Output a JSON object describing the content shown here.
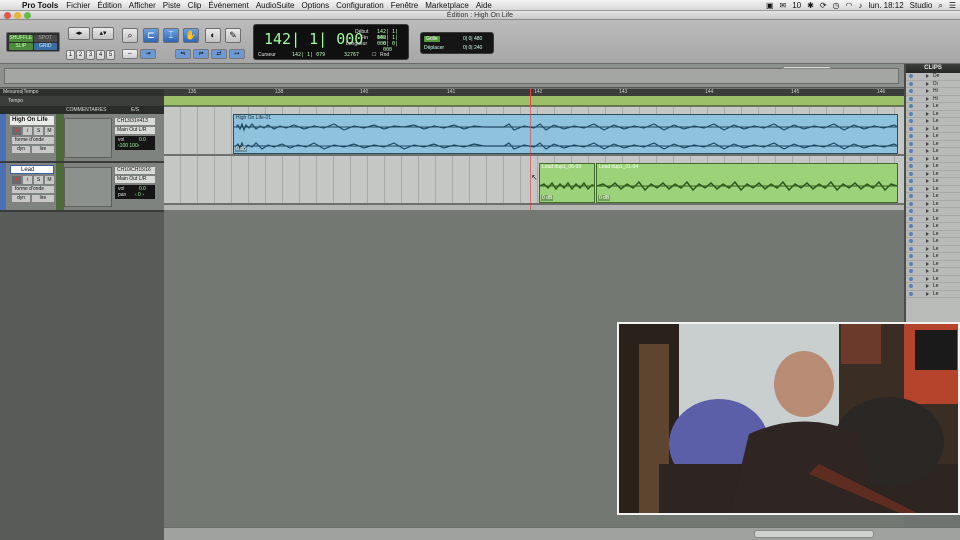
{
  "menubar": {
    "app_name": "Pro Tools",
    "items": [
      "Fichier",
      "Édition",
      "Afficher",
      "Piste",
      "Clip",
      "Événement",
      "AudioSuite",
      "Options",
      "Configuration",
      "Fenêtre",
      "Marketplace",
      "Aide"
    ],
    "status_badge": "10",
    "clock": "lun. 18:12",
    "user": "Studio"
  },
  "window": {
    "title": "Édition : High On Life"
  },
  "toolbar": {
    "modes": [
      "SHUFFLE",
      "SPOT",
      "SLIP",
      "GRID"
    ],
    "zoom_presets": [
      "1",
      "2",
      "3",
      "4",
      "5"
    ]
  },
  "counter": {
    "main": "142| 1| 000",
    "start_label": "Début",
    "end_label": "Fin",
    "length_label": "Longueur",
    "start_value": "142| 1| 000",
    "end_value": "142| 1| 000",
    "length_value": "0| 0| 000",
    "cursor_label": "Curseur",
    "cursor_value": "142| 1| 079",
    "sample_value": "32767",
    "rnd_label": "Rnd"
  },
  "grid": {
    "grid_label": "Grille",
    "grid_value": "0| 0| 480",
    "nudge_label": "Déplacer",
    "nudge_value": "0| 0| 240"
  },
  "timeline": {
    "ruler_label": "Mesures|Tempo",
    "tempo_label": "Tempo",
    "bars": [
      "135",
      "138",
      "140",
      "141",
      "142",
      "143",
      "144",
      "145",
      "146"
    ]
  },
  "columns": {
    "comments": "COMMENTAIRES",
    "io": "E/S"
  },
  "tracks": [
    {
      "name": "High On Life",
      "view": "forme d'onde",
      "input": "CH13/31#413",
      "output": "Main Out L/R",
      "vol_label": "vol",
      "vol": "0.0",
      "pan": "‹100   100›",
      "dyn_label": "dyn",
      "lire_label": "lire",
      "clips": [
        {
          "name": "High On Life-01",
          "gain": "0 dB"
        }
      ]
    },
    {
      "name": "Lead",
      "view": "forme d'onde",
      "input": "CH10/CH15/16",
      "output": "Main Out L/R",
      "vol_label": "vol",
      "vol": "0.0",
      "pan_label": "pan",
      "pan": "‹ 0 ›",
      "dyn_label": "dyn",
      "lire_label": "lire",
      "clips": [
        {
          "name": "Lead dup1_06-03",
          "gain": "0 dB"
        },
        {
          "name": "Lead dup1_01-04",
          "gain": "0 dB"
        }
      ]
    }
  ],
  "clips_panel": {
    "title": "CLIPS",
    "rows": [
      "De",
      "Di",
      "Hi",
      "Hi",
      "Le",
      "Le",
      "Le",
      "Le",
      "Le",
      "Le",
      "Le",
      "Le",
      "Le",
      "Le",
      "Le",
      "Le",
      "Le",
      "Le",
      "Le",
      "Le",
      "Le",
      "Le",
      "Le",
      "Le",
      "Le",
      "Le",
      "Le",
      "Le",
      "Le",
      "Le"
    ]
  },
  "colors": {
    "clip_blue": "#8fc2dc",
    "clip_green": "#9cd27a",
    "tempo_green": "#9cc06a",
    "counter_green": "#9dff9d"
  }
}
